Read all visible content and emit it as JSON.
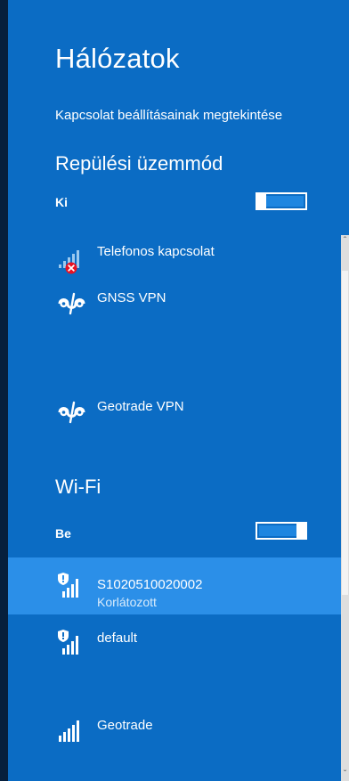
{
  "panel": {
    "title": "Hálózatok",
    "settings_link": "Kapcsolat beállításainak megtekintése"
  },
  "airplane": {
    "title": "Repülési üzemmód",
    "state": "Ki",
    "is_on": false
  },
  "connections": [
    {
      "name": "Telefonos kapcsolat",
      "icon": "dialup-signal-error-icon"
    },
    {
      "name": "GNSS VPN",
      "icon": "vpn-icon"
    },
    {
      "name": "Geotrade VPN",
      "icon": "vpn-icon"
    }
  ],
  "wifi": {
    "title": "Wi-Fi",
    "state": "Be",
    "is_on": true,
    "networks": [
      {
        "name": "S1020510020002",
        "status": "Korlátozott",
        "selected": true,
        "icon": "wifi-shield-signal-icon"
      },
      {
        "name": "default",
        "status": "",
        "selected": false,
        "icon": "wifi-shield-signal-icon"
      },
      {
        "name": "Geotrade",
        "status": "",
        "selected": false,
        "icon": "wifi-signal-icon"
      }
    ]
  },
  "colors": {
    "background": "#0b6cc4",
    "selected_row": "#2b8fe8",
    "error_red": "#e81123"
  }
}
